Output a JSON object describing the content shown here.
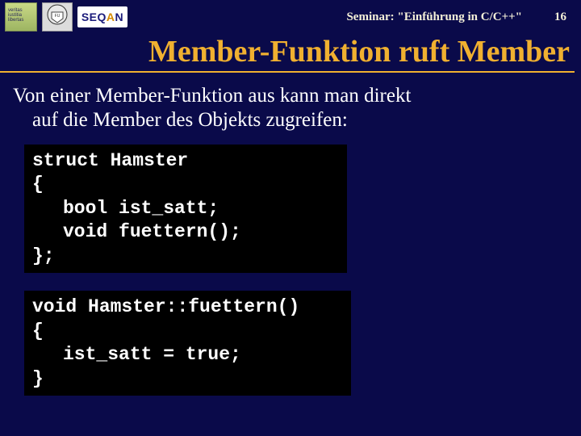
{
  "header": {
    "logos": {
      "veritas_text": "veritas\niustitia\nlibertas",
      "seqan": {
        "seq": "SEQ",
        "a": "A",
        "n": "N"
      }
    },
    "seminar_label": "Seminar: \"Einführung in C/C++\"",
    "page_number": "16"
  },
  "title": "Member-Funktion ruft Member",
  "body": {
    "line1": "Von einer Member-Funktion aus kann man direkt",
    "line2": "auf die Member des Objekts zugreifen:"
  },
  "code1": {
    "l1": "struct Hamster",
    "l2": "{",
    "l3": "bool ist_satt;",
    "l4": "void fuettern();",
    "l5": "};"
  },
  "code2": {
    "l1": "void Hamster::fuettern()",
    "l2": "{",
    "l3": "ist_satt = true;",
    "l4": "}"
  }
}
